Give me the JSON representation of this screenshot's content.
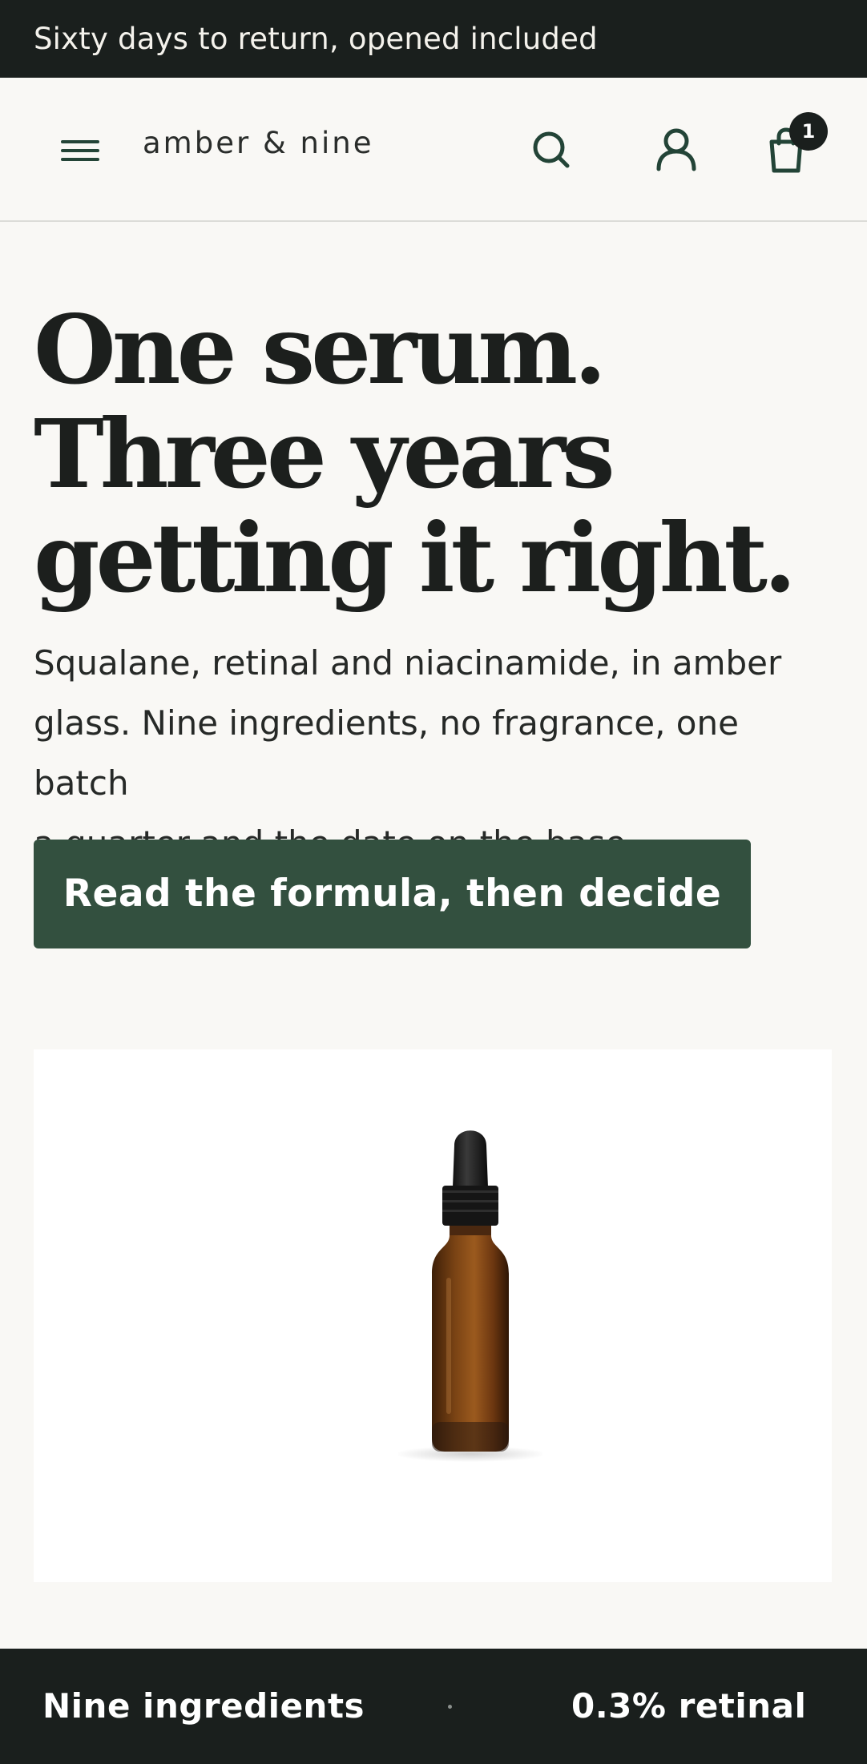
{
  "announcement": "Sixty days to return, opened included",
  "header": {
    "brand": "amber & nine",
    "menu_icon": "menu-icon",
    "search_icon": "search-icon",
    "account_icon": "user-icon",
    "cart_icon": "shopping-bag-icon",
    "cart_count": "1"
  },
  "hero": {
    "title_lines": [
      "One serum.",
      "Three years",
      "getting it right."
    ],
    "subtitle_lines": [
      "Squalane, retinal and niacinamide, in amber",
      "glass. Nine ingredients, no fragrance, one batch",
      "a quarter and the date on the base."
    ],
    "cta_label": "Read the formula, then decide"
  },
  "product": {
    "image": "amber-dropper-bottle"
  },
  "strip": {
    "left": "Nine ingredients",
    "right": "0.3% retinal"
  },
  "colors": {
    "dark": "#1a1f1d",
    "accent_green": "#33503f",
    "page_bg": "#f9f8f5",
    "icon_green": "#234437"
  }
}
